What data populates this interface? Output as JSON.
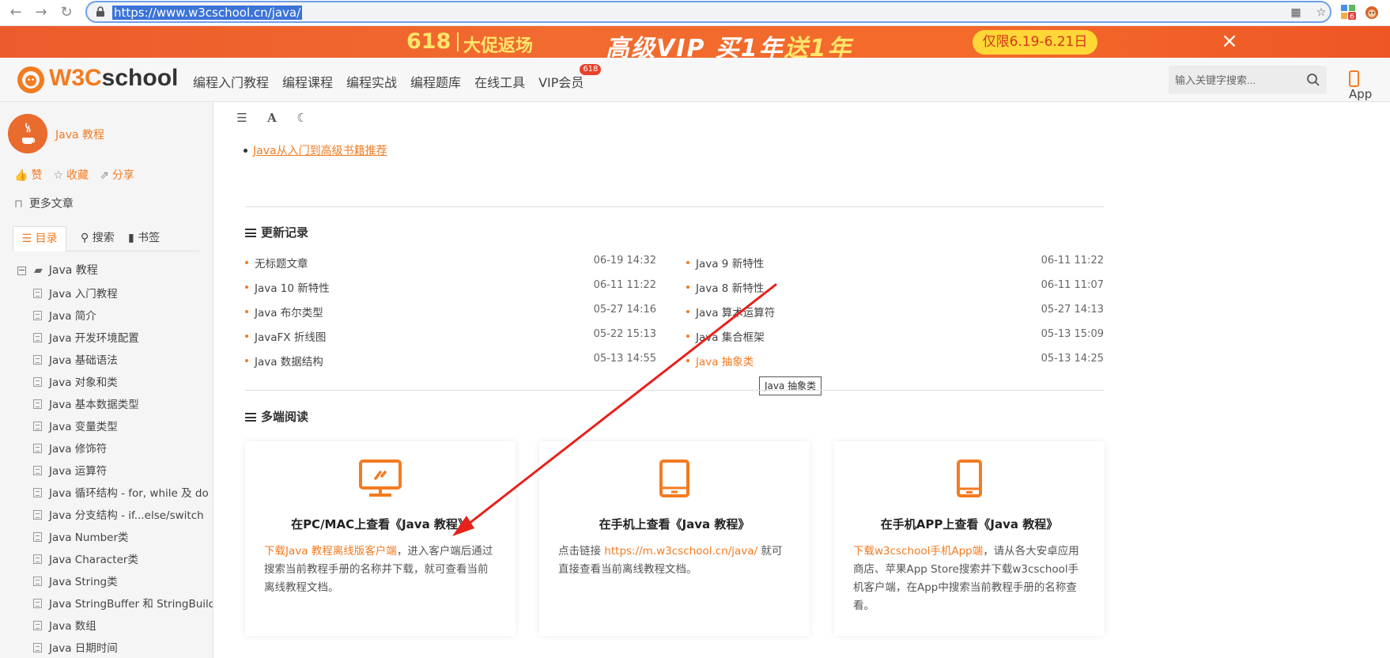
{
  "browser": {
    "url": "https://www.w3cschool.cn/java/",
    "extension_badge": "6"
  },
  "promo": {
    "num": "618",
    "sale": "大促返场",
    "vip_a": "高级VIP  买1年",
    "vip_b": "送1年",
    "pill": "仅限6.19-6.21日",
    "close": "×"
  },
  "header": {
    "logo_w3": "W3C",
    "logo_school": "school",
    "nav": [
      "编程入门教程",
      "编程课程",
      "编程实战",
      "编程题库",
      "在线工具",
      "VIP会员"
    ],
    "vip_badge": "618",
    "search_placeholder": "输入关键字搜索...",
    "app": "App"
  },
  "sidebar": {
    "course_title": "Java 教程",
    "like": "赞",
    "collect": "收藏",
    "share": "分享",
    "more_articles": "更多文章",
    "tabs": [
      "目录",
      "搜索",
      "书签"
    ],
    "tree_root": "Java 教程",
    "items": [
      "Java 入门教程",
      "Java 简介",
      "Java 开发环境配置",
      "Java 基础语法",
      "Java 对象和类",
      "Java 基本数据类型",
      "Java 变量类型",
      "Java 修饰符",
      "Java 运算符",
      "Java 循环结构 - for, while 及 do",
      "Java 分支结构 - if...else/switch",
      "Java Number类",
      "Java Character类",
      "Java String类",
      "Java StringBuffer 和 StringBuilde",
      "Java 数组",
      "Java 日期时间"
    ]
  },
  "main": {
    "book_rec": "Java从入门到高级书籍推荐",
    "updates_title": "更新记录",
    "updates_left": [
      {
        "title": "无标题文章",
        "date": "06-19 14:32"
      },
      {
        "title": "Java 10 新特性",
        "date": "06-11 11:22"
      },
      {
        "title": "Java 布尔类型",
        "date": "05-27 14:16"
      },
      {
        "title": "JavaFX 折线图",
        "date": "05-22 15:13"
      },
      {
        "title": "Java 数据结构",
        "date": "05-13 14:55"
      }
    ],
    "updates_right": [
      {
        "title": "Java 9 新特性",
        "date": "06-11 11:22"
      },
      {
        "title": "Java 8 新特性",
        "date": "06-11 11:07"
      },
      {
        "title": "Java 算术运算符",
        "date": "05-27 14:13"
      },
      {
        "title": "Java 集合框架",
        "date": "05-13 15:09"
      },
      {
        "title": "Java 抽象类",
        "date": "05-13 14:25"
      }
    ],
    "tooltip": "Java 抽象类",
    "multi_title": "多端阅读",
    "cards": [
      {
        "title": "在PC/MAC上查看《Java 教程》",
        "link": "下载Java 教程离线版客户端",
        "text": "，进入客户端后通过搜索当前教程手册的名称并下载，就可查看当前离线教程文档。"
      },
      {
        "title": "在手机上查看《Java 教程》",
        "prefix": "点击链接 ",
        "link": "https://m.w3cschool.cn/java/",
        "text": " 就可直接查看当前离线教程文档。"
      },
      {
        "title": "在手机APP上查看《Java 教程》",
        "link": "下载w3cschool手机App端",
        "text": "，请从各大安卓应用商店、苹果App Store搜索并下载w3cschool手机客户端，在App中搜索当前教程手册的名称查看。"
      }
    ]
  },
  "colors": {
    "accent": "#f37b21",
    "promo_bg": "#f0622c",
    "annotation_arrow": "#e8201a"
  }
}
